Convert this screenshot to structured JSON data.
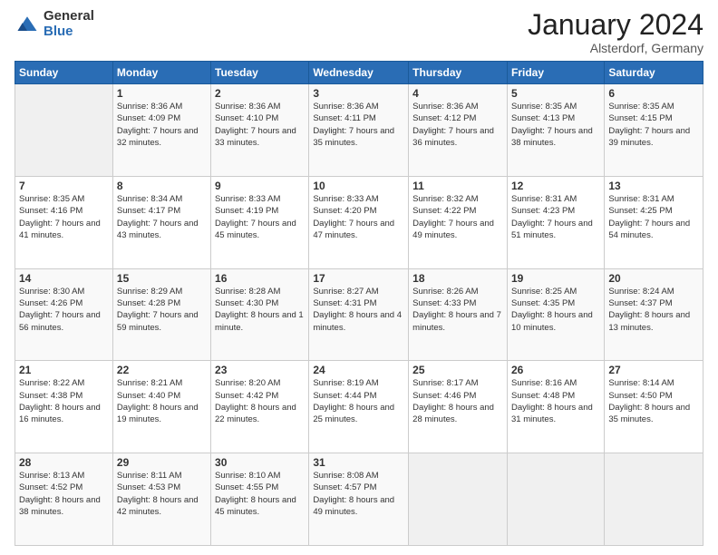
{
  "header": {
    "logo_general": "General",
    "logo_blue": "Blue",
    "month_title": "January 2024",
    "location": "Alsterdorf, Germany"
  },
  "weekdays": [
    "Sunday",
    "Monday",
    "Tuesday",
    "Wednesday",
    "Thursday",
    "Friday",
    "Saturday"
  ],
  "weeks": [
    [
      {
        "num": "",
        "sunrise": "",
        "sunset": "",
        "daylight": "",
        "empty": true
      },
      {
        "num": "1",
        "sunrise": "Sunrise: 8:36 AM",
        "sunset": "Sunset: 4:09 PM",
        "daylight": "Daylight: 7 hours and 32 minutes."
      },
      {
        "num": "2",
        "sunrise": "Sunrise: 8:36 AM",
        "sunset": "Sunset: 4:10 PM",
        "daylight": "Daylight: 7 hours and 33 minutes."
      },
      {
        "num": "3",
        "sunrise": "Sunrise: 8:36 AM",
        "sunset": "Sunset: 4:11 PM",
        "daylight": "Daylight: 7 hours and 35 minutes."
      },
      {
        "num": "4",
        "sunrise": "Sunrise: 8:36 AM",
        "sunset": "Sunset: 4:12 PM",
        "daylight": "Daylight: 7 hours and 36 minutes."
      },
      {
        "num": "5",
        "sunrise": "Sunrise: 8:35 AM",
        "sunset": "Sunset: 4:13 PM",
        "daylight": "Daylight: 7 hours and 38 minutes."
      },
      {
        "num": "6",
        "sunrise": "Sunrise: 8:35 AM",
        "sunset": "Sunset: 4:15 PM",
        "daylight": "Daylight: 7 hours and 39 minutes."
      }
    ],
    [
      {
        "num": "7",
        "sunrise": "Sunrise: 8:35 AM",
        "sunset": "Sunset: 4:16 PM",
        "daylight": "Daylight: 7 hours and 41 minutes."
      },
      {
        "num": "8",
        "sunrise": "Sunrise: 8:34 AM",
        "sunset": "Sunset: 4:17 PM",
        "daylight": "Daylight: 7 hours and 43 minutes."
      },
      {
        "num": "9",
        "sunrise": "Sunrise: 8:33 AM",
        "sunset": "Sunset: 4:19 PM",
        "daylight": "Daylight: 7 hours and 45 minutes."
      },
      {
        "num": "10",
        "sunrise": "Sunrise: 8:33 AM",
        "sunset": "Sunset: 4:20 PM",
        "daylight": "Daylight: 7 hours and 47 minutes."
      },
      {
        "num": "11",
        "sunrise": "Sunrise: 8:32 AM",
        "sunset": "Sunset: 4:22 PM",
        "daylight": "Daylight: 7 hours and 49 minutes."
      },
      {
        "num": "12",
        "sunrise": "Sunrise: 8:31 AM",
        "sunset": "Sunset: 4:23 PM",
        "daylight": "Daylight: 7 hours and 51 minutes."
      },
      {
        "num": "13",
        "sunrise": "Sunrise: 8:31 AM",
        "sunset": "Sunset: 4:25 PM",
        "daylight": "Daylight: 7 hours and 54 minutes."
      }
    ],
    [
      {
        "num": "14",
        "sunrise": "Sunrise: 8:30 AM",
        "sunset": "Sunset: 4:26 PM",
        "daylight": "Daylight: 7 hours and 56 minutes."
      },
      {
        "num": "15",
        "sunrise": "Sunrise: 8:29 AM",
        "sunset": "Sunset: 4:28 PM",
        "daylight": "Daylight: 7 hours and 59 minutes."
      },
      {
        "num": "16",
        "sunrise": "Sunrise: 8:28 AM",
        "sunset": "Sunset: 4:30 PM",
        "daylight": "Daylight: 8 hours and 1 minute."
      },
      {
        "num": "17",
        "sunrise": "Sunrise: 8:27 AM",
        "sunset": "Sunset: 4:31 PM",
        "daylight": "Daylight: 8 hours and 4 minutes."
      },
      {
        "num": "18",
        "sunrise": "Sunrise: 8:26 AM",
        "sunset": "Sunset: 4:33 PM",
        "daylight": "Daylight: 8 hours and 7 minutes."
      },
      {
        "num": "19",
        "sunrise": "Sunrise: 8:25 AM",
        "sunset": "Sunset: 4:35 PM",
        "daylight": "Daylight: 8 hours and 10 minutes."
      },
      {
        "num": "20",
        "sunrise": "Sunrise: 8:24 AM",
        "sunset": "Sunset: 4:37 PM",
        "daylight": "Daylight: 8 hours and 13 minutes."
      }
    ],
    [
      {
        "num": "21",
        "sunrise": "Sunrise: 8:22 AM",
        "sunset": "Sunset: 4:38 PM",
        "daylight": "Daylight: 8 hours and 16 minutes."
      },
      {
        "num": "22",
        "sunrise": "Sunrise: 8:21 AM",
        "sunset": "Sunset: 4:40 PM",
        "daylight": "Daylight: 8 hours and 19 minutes."
      },
      {
        "num": "23",
        "sunrise": "Sunrise: 8:20 AM",
        "sunset": "Sunset: 4:42 PM",
        "daylight": "Daylight: 8 hours and 22 minutes."
      },
      {
        "num": "24",
        "sunrise": "Sunrise: 8:19 AM",
        "sunset": "Sunset: 4:44 PM",
        "daylight": "Daylight: 8 hours and 25 minutes."
      },
      {
        "num": "25",
        "sunrise": "Sunrise: 8:17 AM",
        "sunset": "Sunset: 4:46 PM",
        "daylight": "Daylight: 8 hours and 28 minutes."
      },
      {
        "num": "26",
        "sunrise": "Sunrise: 8:16 AM",
        "sunset": "Sunset: 4:48 PM",
        "daylight": "Daylight: 8 hours and 31 minutes."
      },
      {
        "num": "27",
        "sunrise": "Sunrise: 8:14 AM",
        "sunset": "Sunset: 4:50 PM",
        "daylight": "Daylight: 8 hours and 35 minutes."
      }
    ],
    [
      {
        "num": "28",
        "sunrise": "Sunrise: 8:13 AM",
        "sunset": "Sunset: 4:52 PM",
        "daylight": "Daylight: 8 hours and 38 minutes."
      },
      {
        "num": "29",
        "sunrise": "Sunrise: 8:11 AM",
        "sunset": "Sunset: 4:53 PM",
        "daylight": "Daylight: 8 hours and 42 minutes."
      },
      {
        "num": "30",
        "sunrise": "Sunrise: 8:10 AM",
        "sunset": "Sunset: 4:55 PM",
        "daylight": "Daylight: 8 hours and 45 minutes."
      },
      {
        "num": "31",
        "sunrise": "Sunrise: 8:08 AM",
        "sunset": "Sunset: 4:57 PM",
        "daylight": "Daylight: 8 hours and 49 minutes."
      },
      {
        "num": "",
        "sunrise": "",
        "sunset": "",
        "daylight": "",
        "empty": true
      },
      {
        "num": "",
        "sunrise": "",
        "sunset": "",
        "daylight": "",
        "empty": true
      },
      {
        "num": "",
        "sunrise": "",
        "sunset": "",
        "daylight": "",
        "empty": true
      }
    ]
  ]
}
